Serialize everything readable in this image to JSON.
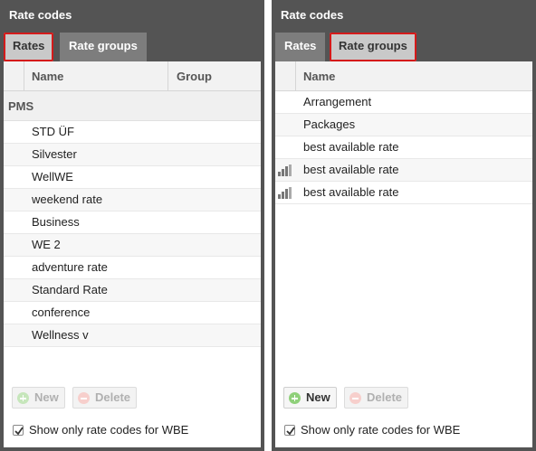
{
  "left_panel": {
    "title": "Rate codes",
    "tabs": [
      {
        "label": "Rates",
        "active": true
      },
      {
        "label": "Rate groups",
        "active": false
      }
    ],
    "columns": [
      "Name",
      "Group"
    ],
    "group_label": "PMS",
    "rows": [
      "STD ÜF",
      "Silvester",
      "WellWE",
      "weekend rate",
      "Business",
      "WE 2",
      "adventure rate",
      "Standard Rate",
      "conference",
      "Wellness v"
    ],
    "buttons": {
      "new": "New",
      "delete": "Delete"
    },
    "checkbox": {
      "label": "Show only rate codes for WBE",
      "checked": true
    }
  },
  "right_panel": {
    "title": "Rate codes",
    "tabs": [
      {
        "label": "Rates",
        "active": false
      },
      {
        "label": "Rate groups",
        "active": true
      }
    ],
    "columns": [
      "Name"
    ],
    "rows": [
      {
        "name": "Arrangement",
        "icon": null
      },
      {
        "name": "Packages",
        "icon": null
      },
      {
        "name": "best available rate",
        "icon": null
      },
      {
        "name": "best available rate",
        "icon": "bar-chart-icon"
      },
      {
        "name": "best available rate",
        "icon": "bar-chart-icon"
      }
    ],
    "buttons": {
      "new": "New",
      "delete": "Delete"
    },
    "checkbox": {
      "label": "Show only rate codes for WBE",
      "checked": true
    }
  },
  "colors": {
    "panel_bg": "#545454",
    "tab_active": "#c9c9c9",
    "tab_inactive": "#7d7d7d",
    "highlight": "#d41a1a"
  }
}
